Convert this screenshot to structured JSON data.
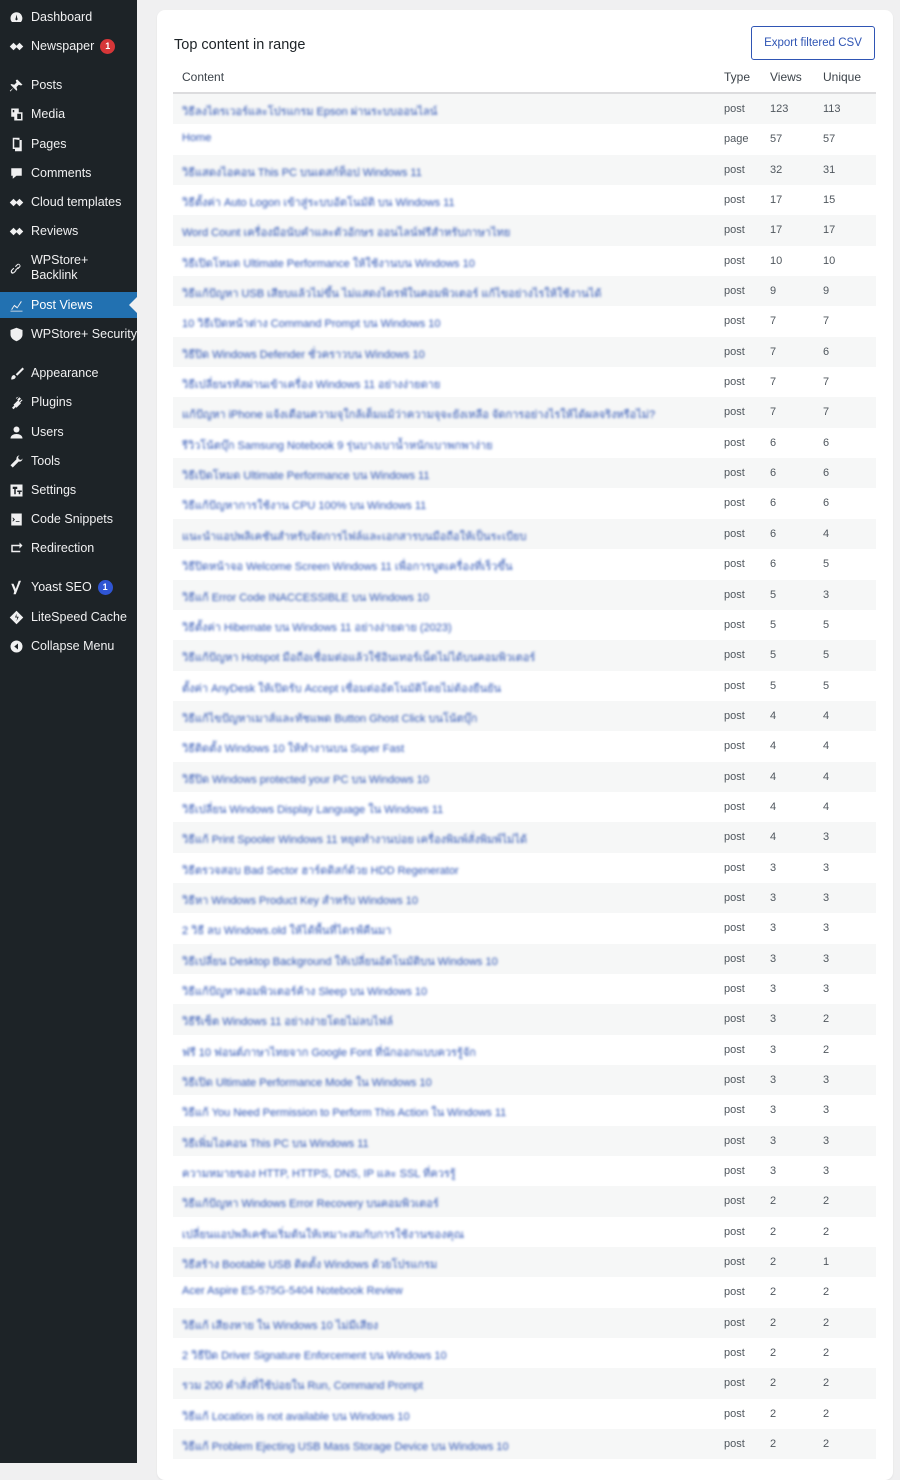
{
  "sidebar": {
    "items": [
      {
        "label": "Dashboard",
        "icon": "dashboard-icon"
      },
      {
        "label": "Newspaper",
        "icon": "newspaper-icon",
        "badge": "1",
        "badge_color": "#d63638"
      },
      {
        "label": "Posts",
        "icon": "pin-icon"
      },
      {
        "label": "Media",
        "icon": "media-icon"
      },
      {
        "label": "Pages",
        "icon": "pages-icon"
      },
      {
        "label": "Comments",
        "icon": "comments-icon"
      },
      {
        "label": "Cloud templates",
        "icon": "diamond-icon"
      },
      {
        "label": "Reviews",
        "icon": "diamond-icon"
      },
      {
        "label": "WPStore+ Backlink",
        "icon": "link-icon"
      },
      {
        "label": "Post Views",
        "icon": "chart-icon",
        "active": true
      },
      {
        "label": "WPStore+ Security",
        "icon": "shield-icon"
      },
      {
        "label": "Appearance",
        "icon": "brush-icon"
      },
      {
        "label": "Plugins",
        "icon": "plugin-icon"
      },
      {
        "label": "Users",
        "icon": "user-icon"
      },
      {
        "label": "Tools",
        "icon": "wrench-icon"
      },
      {
        "label": "Settings",
        "icon": "settings-icon"
      },
      {
        "label": "Code Snippets",
        "icon": "code-icon"
      },
      {
        "label": "Redirection",
        "icon": "redirect-icon"
      },
      {
        "label": "Yoast SEO",
        "icon": "yoast-icon",
        "badge": "1",
        "badge_color": "#2f55d4"
      },
      {
        "label": "LiteSpeed Cache",
        "icon": "litespeed-icon"
      },
      {
        "label": "Collapse Menu",
        "icon": "collapse-icon"
      }
    ]
  },
  "card": {
    "title": "Top content in range",
    "export_label": "Export filtered CSV"
  },
  "table": {
    "headers": {
      "content": "Content",
      "type": "Type",
      "views": "Views",
      "unique": "Unique"
    },
    "rows": [
      {
        "content": "วิธีลงไดรเวอร์และโปรแกรม Epson ผ่านระบบออนไลน์",
        "type": "post",
        "views": "123",
        "unique": "113"
      },
      {
        "content": "Home",
        "type": "page",
        "views": "57",
        "unique": "57"
      },
      {
        "content": "วิธีแสดงไอคอน This PC บนเดสก์ท็อป Windows 11",
        "type": "post",
        "views": "32",
        "unique": "31"
      },
      {
        "content": "วิธีตั้งค่า Auto Logon เข้าสู่ระบบอัตโนมัติ บน Windows 11",
        "type": "post",
        "views": "17",
        "unique": "15"
      },
      {
        "content": "Word Count เครื่องมือนับคำและตัวอักษร ออนไลน์ฟรีสำหรับภาษาไทย",
        "type": "post",
        "views": "17",
        "unique": "17"
      },
      {
        "content": "วิธีเปิดโหมด Ultimate Performance ให้ใช้งานบน Windows 10",
        "type": "post",
        "views": "10",
        "unique": "10"
      },
      {
        "content": "วิธีแก้ปัญหา USB เสียบแล้วไม่ขึ้น ไม่แสดงไดรฟ์ในคอมพิวเตอร์ แก้ไขอย่างไรให้ใช้งานได้",
        "type": "post",
        "views": "9",
        "unique": "9"
      },
      {
        "content": "10 วิธีเปิดหน้าต่าง Command Prompt บน Windows 10",
        "type": "post",
        "views": "7",
        "unique": "7"
      },
      {
        "content": "วิธีปิด Windows Defender ชั่วคราวบน Windows 10",
        "type": "post",
        "views": "7",
        "unique": "6"
      },
      {
        "content": "วิธีเปลี่ยนรหัสผ่านเข้าเครื่อง Windows 11 อย่างง่ายดาย",
        "type": "post",
        "views": "7",
        "unique": "7"
      },
      {
        "content": "แก้ปัญหา iPhone แจ้งเตือนความจุใกล้เต็มแม้ว่าความจุจะยังเหลือ จัดการอย่างไรให้ได้ผลจริงหรือไม่?",
        "type": "post",
        "views": "7",
        "unique": "7"
      },
      {
        "content": "รีวิวโน้ตบุ๊ก Samsung Notebook 9 รุ่นบางเบาน้ำหนักเบาพกพาง่าย",
        "type": "post",
        "views": "6",
        "unique": "6"
      },
      {
        "content": "วิธีเปิดโหมด Ultimate Performance บน Windows 11",
        "type": "post",
        "views": "6",
        "unique": "6"
      },
      {
        "content": "วิธีแก้ปัญหาการใช้งาน CPU 100% บน Windows 11",
        "type": "post",
        "views": "6",
        "unique": "6"
      },
      {
        "content": "แนะนำแอปพลิเคชันสำหรับจัดการไฟล์และเอกสารบนมือถือให้เป็นระเบียบ",
        "type": "post",
        "views": "6",
        "unique": "4"
      },
      {
        "content": "วิธีปิดหน้าจอ Welcome Screen Windows 11 เพื่อการบูตเครื่องที่เร็วขึ้น",
        "type": "post",
        "views": "6",
        "unique": "5"
      },
      {
        "content": "วิธีแก้ Error Code INACCESSIBLE บน Windows 10",
        "type": "post",
        "views": "5",
        "unique": "3"
      },
      {
        "content": "วิธีตั้งค่า Hibernate บน Windows 11 อย่างง่ายดาย (2023)",
        "type": "post",
        "views": "5",
        "unique": "5"
      },
      {
        "content": "วิธีแก้ปัญหา Hotspot มือถือเชื่อมต่อแล้วใช้อินเทอร์เน็ตไม่ได้บนคอมพิวเตอร์",
        "type": "post",
        "views": "5",
        "unique": "5"
      },
      {
        "content": "ตั้งค่า AnyDesk ให้เปิดรับ Accept เชื่อมต่ออัตโนมัติโดยไม่ต้องยืนยัน",
        "type": "post",
        "views": "5",
        "unique": "5"
      },
      {
        "content": "วิธีแก้ไขปัญหาเมาส์และทัชแพด Button Ghost Click บนโน้ตบุ๊ก",
        "type": "post",
        "views": "4",
        "unique": "4"
      },
      {
        "content": "วิธีติดตั้ง Windows 10 ให้ทำงานบน Super Fast",
        "type": "post",
        "views": "4",
        "unique": "4"
      },
      {
        "content": "วิธีปิด Windows protected your PC บน Windows 10",
        "type": "post",
        "views": "4",
        "unique": "4"
      },
      {
        "content": "วิธีเปลี่ยน Windows Display Language ใน Windows 11",
        "type": "post",
        "views": "4",
        "unique": "4"
      },
      {
        "content": "วิธีแก้ Print Spooler Windows 11 หยุดทำงานบ่อย เครื่องพิมพ์สั่งพิมพ์ไม่ได้",
        "type": "post",
        "views": "4",
        "unique": "3"
      },
      {
        "content": "วิธีตรวจสอบ Bad Sector ฮาร์ดดิสก์ด้วย HDD Regenerator",
        "type": "post",
        "views": "3",
        "unique": "3"
      },
      {
        "content": "วิธีหา Windows Product Key สำหรับ Windows 10",
        "type": "post",
        "views": "3",
        "unique": "3"
      },
      {
        "content": "2 วิธี ลบ Windows.old ให้ได้พื้นที่ไดรฟ์คืนมา",
        "type": "post",
        "views": "3",
        "unique": "3"
      },
      {
        "content": "วิธีเปลี่ยน Desktop Background ให้เปลี่ยนอัตโนมัติบน Windows 10",
        "type": "post",
        "views": "3",
        "unique": "3"
      },
      {
        "content": "วิธีแก้ปัญหาคอมพิวเตอร์ค้าง Sleep บน Windows 10",
        "type": "post",
        "views": "3",
        "unique": "3"
      },
      {
        "content": "วิธีรีเซ็ต Windows 11 อย่างง่ายโดยไม่ลบไฟล์",
        "type": "post",
        "views": "3",
        "unique": "2"
      },
      {
        "content": "ฟรี 10 ฟอนต์ภาษาไทยจาก Google Font ที่นักออกแบบควรรู้จัก",
        "type": "post",
        "views": "3",
        "unique": "2"
      },
      {
        "content": "วิธีเปิด Ultimate Performance Mode ใน Windows 10",
        "type": "post",
        "views": "3",
        "unique": "3"
      },
      {
        "content": "วิธีแก้ You Need Permission to Perform This Action ใน Windows 11",
        "type": "post",
        "views": "3",
        "unique": "3"
      },
      {
        "content": "วิธีเพิ่มไอคอน This PC บน Windows 11",
        "type": "post",
        "views": "3",
        "unique": "3"
      },
      {
        "content": "ความหมายของ HTTP, HTTPS, DNS, IP และ SSL ที่ควรรู้",
        "type": "post",
        "views": "3",
        "unique": "3"
      },
      {
        "content": "วิธีแก้ปัญหา Windows Error Recovery บนคอมพิวเตอร์",
        "type": "post",
        "views": "2",
        "unique": "2"
      },
      {
        "content": "เปลี่ยนแอปพลิเคชันเริ่มต้นให้เหมาะสมกับการใช้งานของคุณ",
        "type": "post",
        "views": "2",
        "unique": "2"
      },
      {
        "content": "วิธีสร้าง Bootable USB ติดตั้ง Windows ด้วยโปรแกรม",
        "type": "post",
        "views": "2",
        "unique": "1"
      },
      {
        "content": "Acer Aspire E5-575G-5404 Notebook Review",
        "type": "post",
        "views": "2",
        "unique": "2"
      },
      {
        "content": "วิธีแก้ เสียงหาย ใน Windows 10 ไม่มีเสียง",
        "type": "post",
        "views": "2",
        "unique": "2"
      },
      {
        "content": "2 วิธีปิด Driver Signature Enforcement บน Windows 10",
        "type": "post",
        "views": "2",
        "unique": "2"
      },
      {
        "content": "รวม 200 คำสั่งที่ใช้บ่อยใน Run, Command Prompt",
        "type": "post",
        "views": "2",
        "unique": "2"
      },
      {
        "content": "วิธีแก้ Location is not available บน Windows 10",
        "type": "post",
        "views": "2",
        "unique": "2"
      },
      {
        "content": "วิธีแก้ Problem Ejecting USB Mass Storage Device บน Windows 10",
        "type": "post",
        "views": "2",
        "unique": "2"
      }
    ]
  }
}
